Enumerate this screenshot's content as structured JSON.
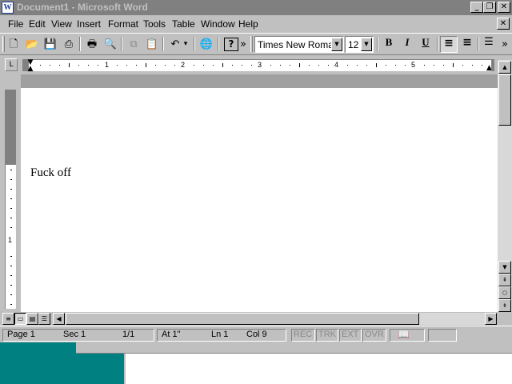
{
  "window": {
    "title": "Document1 - Microsoft Word",
    "app_icon_letter": "W",
    "controls": {
      "minimize": "_",
      "restore": "❐",
      "close": "✕"
    }
  },
  "menu": {
    "items": [
      "File",
      "Edit",
      "View",
      "Insert",
      "Format",
      "Tools",
      "Table",
      "Window",
      "Help"
    ],
    "doc_close": "✕"
  },
  "toolbar": {
    "buttons": {
      "new": "🗋",
      "open": "📂",
      "save": "💾",
      "print_preview_alt": "⎙",
      "print": "🖶",
      "print_preview": "🔍",
      "copy": "⧉",
      "paste": "📋",
      "undo": "↶",
      "undo_dropdown": "▾",
      "web": "🌐",
      "help": "?",
      "more": "»"
    },
    "font_name": "Times New Roman",
    "font_size": "12",
    "dropdown_arrow": "▼",
    "bold": "B",
    "italic": "I",
    "underline": "U",
    "align_left": "≡",
    "align_center": "≡",
    "bullets": "☰",
    "more_right": "»"
  },
  "ruler": {
    "tab_selector": "L",
    "numbers": [
      "1",
      "2",
      "3",
      "4",
      "5"
    ],
    "vertical_number": "1"
  },
  "document": {
    "text": "Fuck off"
  },
  "scrollbar": {
    "up": "▲",
    "down": "▼",
    "prev_page": "⇞",
    "select_browse": "○",
    "next_page": "⇟",
    "left": "◀",
    "right": "▶"
  },
  "view_buttons": {
    "normal": "≡",
    "online": "▭",
    "page_layout": "▤",
    "outline": "☰"
  },
  "status": {
    "page": "Page 1",
    "section": "Sec 1",
    "page_of": "1/1",
    "at": "At 1\"",
    "line": "Ln 1",
    "col": "Col 9",
    "rec": "REC",
    "trk": "TRK",
    "ext": "EXT",
    "ovr": "OVR",
    "book_icon": "📖"
  },
  "colors": {
    "title_inactive": "#808080",
    "face": "#c0c0c0",
    "desktop": "#008080"
  }
}
